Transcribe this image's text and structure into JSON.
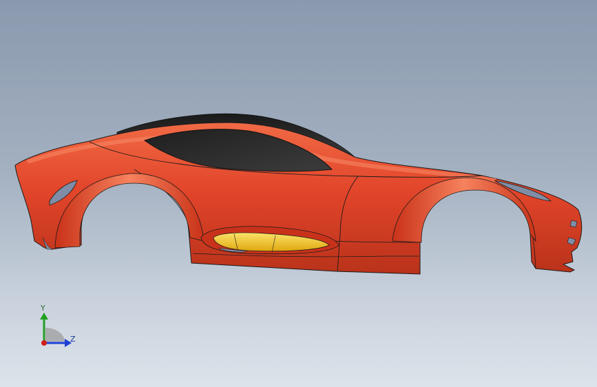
{
  "viewport": {
    "background_top": "#8a99ae",
    "background_bottom": "#dde3ea"
  },
  "model": {
    "body_color": "#e2452a",
    "body_highlight": "#f26a4a",
    "body_shadow": "#a8260f",
    "glass_color": "#2f2f2f",
    "inner_color": "#f2c419",
    "edge_color": "#1a1a1a"
  },
  "triad": {
    "y_label": "Y",
    "z_label": "Z",
    "y_color": "#22a022",
    "z_color": "#1c3fd6",
    "x_color": "#d01c1c"
  }
}
